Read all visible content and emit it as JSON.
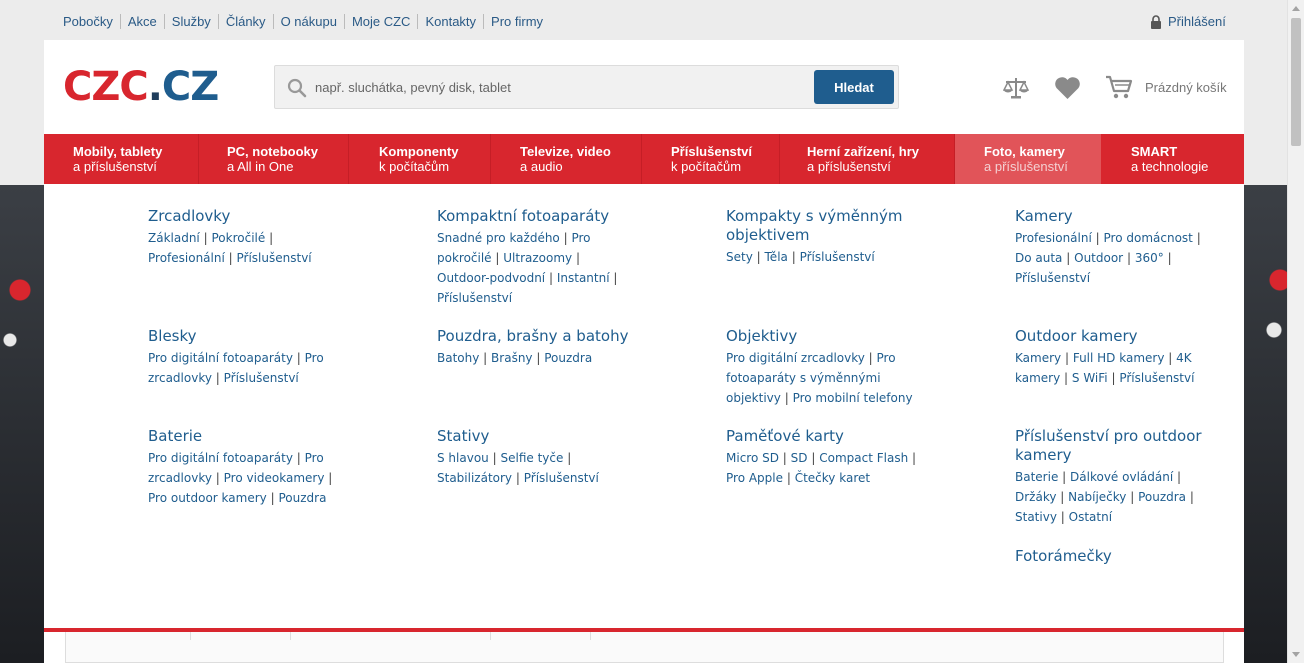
{
  "topbar": {
    "links": [
      "Pobočky",
      "Akce",
      "Služby",
      "Články",
      "O nákupu",
      "Moje CZC",
      "Kontakty",
      "Pro firmy"
    ],
    "login_label": "Přihlášení"
  },
  "header": {
    "logo": {
      "part1": "CZC",
      "dot": ".",
      "part2": "CZ"
    },
    "search_placeholder": "např. sluchátka, pevný disk, tablet",
    "search_button": "Hledat",
    "cart_label": "Prázdný košík"
  },
  "nav": {
    "items": [
      {
        "line1": "Mobily, tablety",
        "line2": "a příslušenství"
      },
      {
        "line1": "PC, notebooky",
        "line2": "a All in One"
      },
      {
        "line1": "Komponenty",
        "line2": "k počítačům"
      },
      {
        "line1": "Televize, video",
        "line2": "a audio"
      },
      {
        "line1": "Příslušenství",
        "line2": "k počítačům"
      },
      {
        "line1": "Herní zařízení, hry",
        "line2": "a příslušenství"
      },
      {
        "line1": "Foto, kamery",
        "line2": "a příslušenství"
      },
      {
        "line1": "SMART",
        "line2": "a technologie"
      }
    ]
  },
  "mega": {
    "categories": [
      {
        "title": "Zrcadlovky",
        "links": [
          "Základní",
          "Pokročilé",
          "Profesionální",
          "Příslušenství"
        ]
      },
      {
        "title": "Kompaktní fotoaparáty",
        "links": [
          "Snadné pro každého",
          "Pro pokročilé",
          "Ultrazoomy",
          "Outdoor-podvodní",
          "Instantní",
          "Příslušenství"
        ]
      },
      {
        "title": "Kompakty s výměnným objektivem",
        "links": [
          "Sety",
          "Těla",
          "Příslušenství"
        ]
      },
      {
        "title": "Kamery",
        "links": [
          "Profesionální",
          "Pro domácnost",
          "Do auta",
          "Outdoor",
          "360°",
          "Příslušenství"
        ]
      },
      {
        "title": "Blesky",
        "links": [
          "Pro digitální fotoaparáty",
          "Pro zrcadlovky",
          "Příslušenství"
        ]
      },
      {
        "title": "Pouzdra, brašny a batohy",
        "links": [
          "Batohy",
          "Brašny",
          "Pouzdra"
        ]
      },
      {
        "title": "Objektivy",
        "links": [
          "Pro digitální zrcadlovky",
          "Pro fotoaparáty s výměnnými objektivy",
          "Pro mobilní telefony"
        ]
      },
      {
        "title": "Outdoor kamery",
        "links": [
          "Kamery",
          "Full HD kamery",
          "4K kamery",
          "S WiFi",
          "Příslušenství"
        ]
      },
      {
        "title": "Baterie",
        "links": [
          "Pro digitální fotoaparáty",
          "Pro zrcadlovky",
          "Pro videokamery",
          "Pro outdoor kamery",
          "Pouzdra"
        ]
      },
      {
        "title": "Stativy",
        "links": [
          "S hlavou",
          "Selfie tyče",
          "Stabilizátory",
          "Příslušenství"
        ]
      },
      {
        "title": "Paměťové karty",
        "links": [
          "Micro SD",
          "SD",
          "Compact Flash",
          "Pro Apple",
          "Čtečky karet"
        ]
      },
      {
        "title": "Příslušenství pro outdoor kamery",
        "links": [
          "Baterie",
          "Dálkové ovládání",
          "Držáky",
          "Nabíječky",
          "Pouzdra",
          "Stativy",
          "Ostatní"
        ]
      },
      {
        "title": "Fotorámečky",
        "links": []
      }
    ]
  },
  "colors": {
    "brand_red": "#d8262e",
    "brand_blue": "#1f5d8e",
    "active_nav": "#e15459"
  }
}
